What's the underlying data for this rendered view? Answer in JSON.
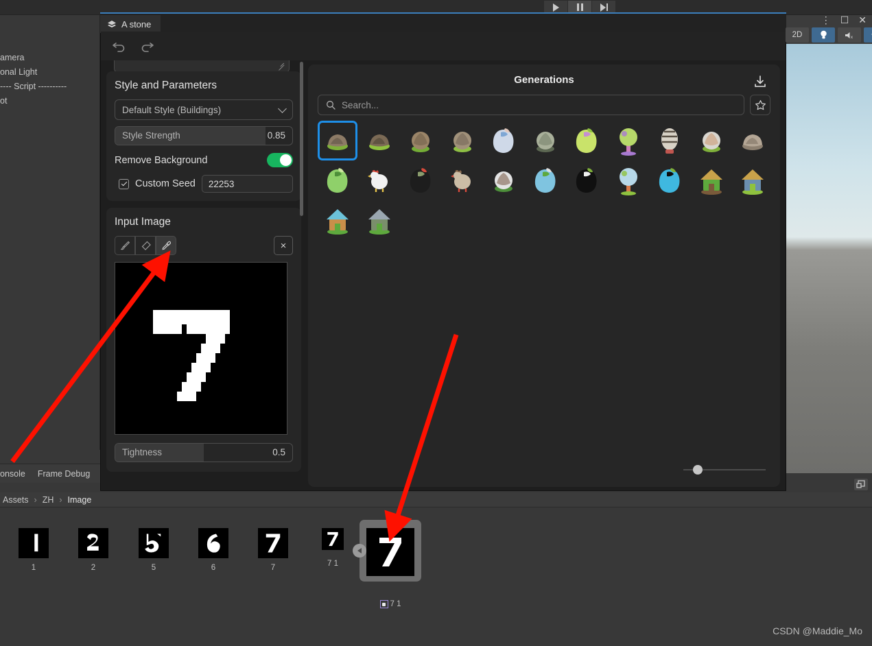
{
  "unity": {
    "playback": [
      {
        "name": "play",
        "icon": "play-icon"
      },
      {
        "name": "pause",
        "icon": "pause-icon"
      },
      {
        "name": "step",
        "icon": "step-icon"
      }
    ],
    "hierarchy_items": [
      "amera",
      "onal Light",
      "---- Script ----------",
      "ot"
    ],
    "bottom_tabs": [
      "onsole",
      "Frame Debug"
    ],
    "scene_toolbar": [
      {
        "label": "2D",
        "name": "toggle-2d",
        "active": false
      },
      {
        "label": "",
        "name": "scene-lighting-toggle",
        "icon": "lightbulb-icon",
        "active": true
      },
      {
        "label": "",
        "name": "scene-audio-toggle",
        "icon": "audio-mute-icon",
        "active": false
      },
      {
        "label": "",
        "name": "scene-effects-toggle",
        "icon": "effects-icon",
        "active": true
      }
    ],
    "window_controls": [
      "more-vertical-icon",
      "maximize-icon",
      "close-icon"
    ]
  },
  "plugin": {
    "tab_label": "A stone",
    "tab_icon": "layers-icon",
    "undo_label": "undo-icon",
    "redo_label": "redo-icon",
    "prompt": {
      "value": "",
      "placeholder": ""
    },
    "style_card": {
      "title": "Style and Parameters",
      "style_select": {
        "value": "Default Style (Buildings)"
      },
      "style_strength": {
        "label": "Style Strength",
        "value": "0.85",
        "fill_pct": 85
      },
      "remove_background": {
        "label": "Remove Background",
        "on": true,
        "color": "#17b55f"
      },
      "custom_seed": {
        "label": "Custom Seed",
        "checked": true,
        "value": "22253"
      }
    },
    "input_card": {
      "title": "Input Image",
      "tools": [
        {
          "name": "brush-tool",
          "icon": "brush-icon",
          "active": false
        },
        {
          "name": "eraser-tool",
          "icon": "eraser-icon",
          "active": false
        },
        {
          "name": "eyedropper-tool",
          "icon": "eyedropper-icon",
          "active": true
        }
      ],
      "clear_button": "×",
      "preview_digit": "7",
      "tightness": {
        "label": "Tightness",
        "value": "0.5",
        "fill_pct": 50
      }
    }
  },
  "generations": {
    "title": "Generations",
    "download_icon": "download-icon",
    "search": {
      "value": "",
      "placeholder": "Search..."
    },
    "favorites_icon": "star-icon",
    "slider_pct": 12,
    "items": [
      {
        "name": "rock-on-grass",
        "selected": true,
        "c1": "#8d7b66",
        "c2": "#5d5244",
        "c3": "#7fb03a",
        "shape": "rock"
      },
      {
        "name": "small-rock-plant",
        "selected": false,
        "c1": "#7b6a55",
        "c2": "#4b4133",
        "c3": "#8fc23f",
        "shape": "rock"
      },
      {
        "name": "mossy-boulder",
        "selected": false,
        "c1": "#9b8568",
        "c2": "#6b5c46",
        "c3": "#74ad36",
        "shape": "round"
      },
      {
        "name": "speckled-stone",
        "selected": false,
        "c1": "#a1917a",
        "c2": "#6d6051",
        "c3": "#8ebf44",
        "shape": "round"
      },
      {
        "name": "blue-slug",
        "selected": false,
        "c1": "#cfd9e8",
        "c2": "#7fa7d4",
        "c3": "#e3c9bd",
        "shape": "blob"
      },
      {
        "name": "green-mound",
        "selected": false,
        "c1": "#a9b09a",
        "c2": "#6f7a63",
        "c3": "#5c6752",
        "shape": "round"
      },
      {
        "name": "pink-mushroom",
        "selected": false,
        "c1": "#c9e36a",
        "c2": "#c58fd2",
        "c3": "#8fc23f",
        "shape": "blob"
      },
      {
        "name": "green-tree",
        "selected": false,
        "c1": "#b7d96a",
        "c2": "#cf7fbb",
        "c3": "#a97ad2",
        "shape": "tree"
      },
      {
        "name": "striped-egg",
        "selected": false,
        "c1": "#d8d2c6",
        "c2": "#5b5246",
        "c3": "#c0564f",
        "shape": "egg"
      },
      {
        "name": "capped-stone",
        "selected": false,
        "c1": "#d9d6cf",
        "c2": "#c98f65",
        "c3": "#7fb03a",
        "shape": "round"
      },
      {
        "name": "plain-pebble",
        "selected": false,
        "c1": "#b4a695",
        "c2": "#7c6f60",
        "c3": "#8d8070",
        "shape": "rock"
      },
      {
        "name": "leaf-sprout",
        "selected": false,
        "c1": "#8fd06a",
        "c2": "#4e8f3a",
        "c3": "#cfe8a0",
        "shape": "blob"
      },
      {
        "name": "white-chicken",
        "selected": false,
        "c1": "#f2f2f2",
        "c2": "#d94b3c",
        "c3": "#e8c44a",
        "shape": "bird"
      },
      {
        "name": "hooded-chicken",
        "selected": false,
        "c1": "#1d1d1d",
        "c2": "#8a9c6d",
        "c3": "#d94b3c",
        "shape": "blob"
      },
      {
        "name": "stone-hat-bird",
        "selected": false,
        "c1": "#cbbda6",
        "c2": "#8a6b4f",
        "c3": "#d94b3c",
        "shape": "bird"
      },
      {
        "name": "framed-sheep",
        "selected": false,
        "c1": "#e3e3e3",
        "c2": "#6b4a33",
        "c3": "#4d8f3a",
        "shape": "round"
      },
      {
        "name": "globe-sprout",
        "selected": false,
        "c1": "#7fc4e0",
        "c2": "#5ea93d",
        "c3": "#e0e0e0",
        "shape": "blob"
      },
      {
        "name": "black-slime",
        "selected": false,
        "c1": "#101010",
        "c2": "#f0f0f0",
        "c3": "#7fb03a",
        "shape": "blob"
      },
      {
        "name": "blue-tree",
        "selected": false,
        "c1": "#b7d8e8",
        "c2": "#d97b4a",
        "c3": "#8fc23f",
        "shape": "tree"
      },
      {
        "name": "cyan-orb-sprout",
        "selected": false,
        "c1": "#3fb8e0",
        "c2": "#0d0d0d",
        "c3": "#7fb03a",
        "shape": "blob"
      },
      {
        "name": "grass-hut",
        "selected": false,
        "c1": "#5ea93d",
        "c2": "#7a5a3a",
        "c3": "#c9a24a",
        "shape": "house"
      },
      {
        "name": "tower-house",
        "selected": false,
        "c1": "#6b8fb0",
        "c2": "#8fc23f",
        "c3": "#c9a24a",
        "shape": "house"
      },
      {
        "name": "wooden-shop",
        "selected": false,
        "c1": "#c98f4a",
        "c2": "#5ea93d",
        "c3": "#6bc2d9",
        "shape": "house"
      },
      {
        "name": "watchtower",
        "selected": false,
        "c1": "#7a8f6b",
        "c2": "#5ea93d",
        "c3": "#9aa7b0",
        "shape": "house"
      }
    ]
  },
  "project": {
    "breadcrumb": [
      "Assets",
      "ZH",
      "Image"
    ],
    "assets": [
      {
        "label": "1",
        "digit": "1",
        "size": 44,
        "selected": false
      },
      {
        "label": "2",
        "digit": "2",
        "size": 44,
        "selected": false
      },
      {
        "label": "5",
        "digit": "5",
        "size": 44,
        "selected": false
      },
      {
        "label": "6",
        "digit": "6",
        "size": 44,
        "selected": false
      },
      {
        "label": "7",
        "digit": "7",
        "size": 44,
        "selected": false
      },
      {
        "label": "7 1",
        "digit": "7",
        "size": 32,
        "selected": false
      },
      {
        "label": "7 1",
        "digit": "7",
        "size": 70,
        "selected": true
      }
    ]
  },
  "watermark": "CSDN @Maddie_Mo"
}
